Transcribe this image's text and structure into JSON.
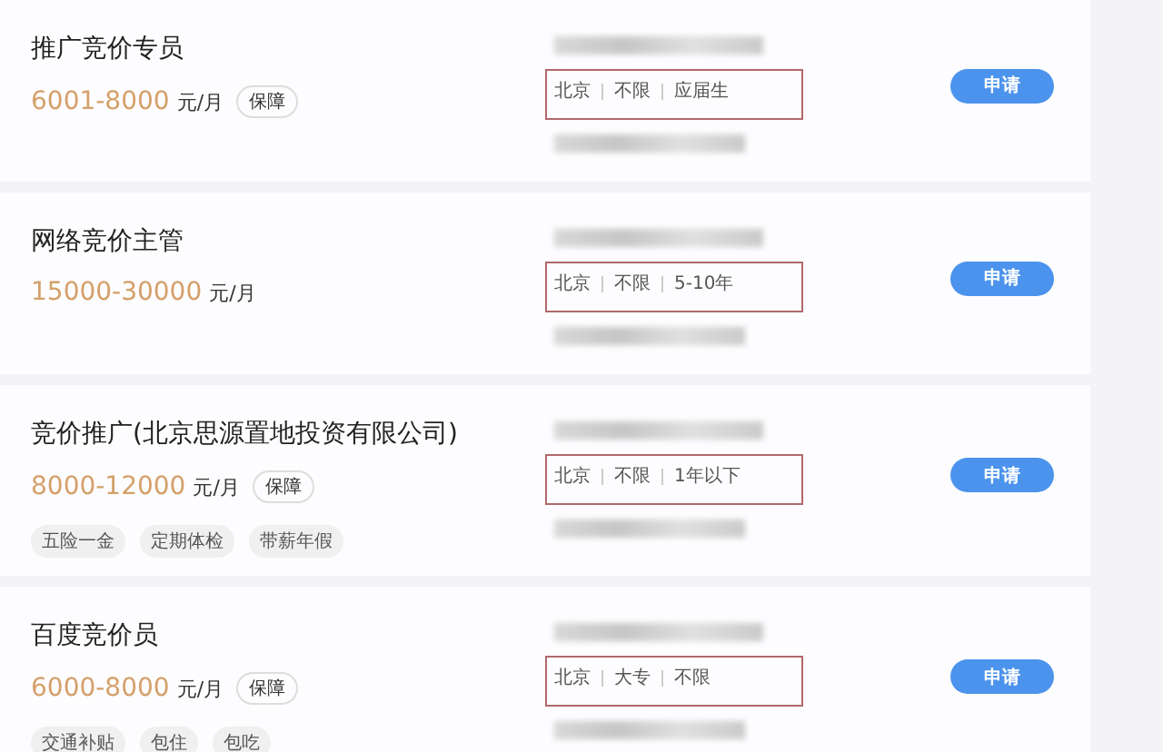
{
  "jobs": [
    {
      "title": "推广竞价专员",
      "salary": "6001-8000",
      "unit": "元/月",
      "badge": "保障",
      "requirements": [
        "北京",
        "不限",
        "应届生"
      ],
      "highlighted": true,
      "apply_label": "申请"
    },
    {
      "title": "网络竞价主管",
      "salary": "15000-30000",
      "unit": "元/月",
      "requirements": [
        "北京",
        "不限",
        "5-10年"
      ],
      "highlighted": true,
      "apply_label": "申请"
    },
    {
      "title": "竞价推广(北京思源置地投资有限公司)",
      "salary": "8000-12000",
      "unit": "元/月",
      "badge": "保障",
      "requirements": [
        "北京",
        "不限",
        "1年以下"
      ],
      "highlighted": true,
      "perks": [
        "五险一金",
        "定期体检",
        "带薪年假"
      ],
      "apply_label": "申请"
    },
    {
      "title": "百度竞价员",
      "salary": "6000-8000",
      "unit": "元/月",
      "badge": "保障",
      "requirements": [
        "北京",
        "大专",
        "不限"
      ],
      "highlighted": true,
      "perks": [
        "交通补贴",
        "包住",
        "包吃"
      ],
      "apply_label": "申请"
    }
  ]
}
